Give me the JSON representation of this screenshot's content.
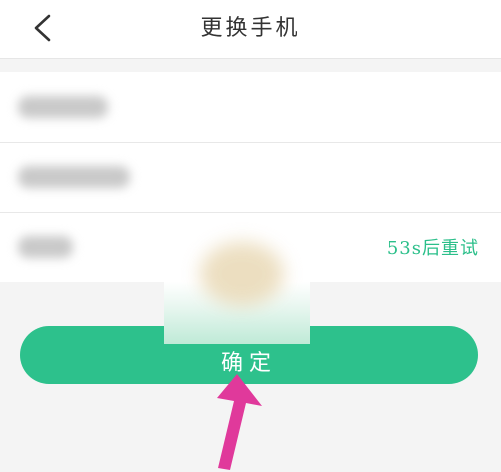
{
  "header": {
    "title": "更换手机",
    "back_icon": "chevron-left-icon"
  },
  "form": {
    "resend_label": "53s后重试"
  },
  "confirm_button": {
    "label": "确定"
  },
  "colors": {
    "accent": "#2dc18c",
    "resend_text": "#2bbf8a",
    "arrow": "#e0399b",
    "background": "#f4f4f4"
  },
  "icons": {
    "annotation_arrow": "arrow-up-icon"
  }
}
